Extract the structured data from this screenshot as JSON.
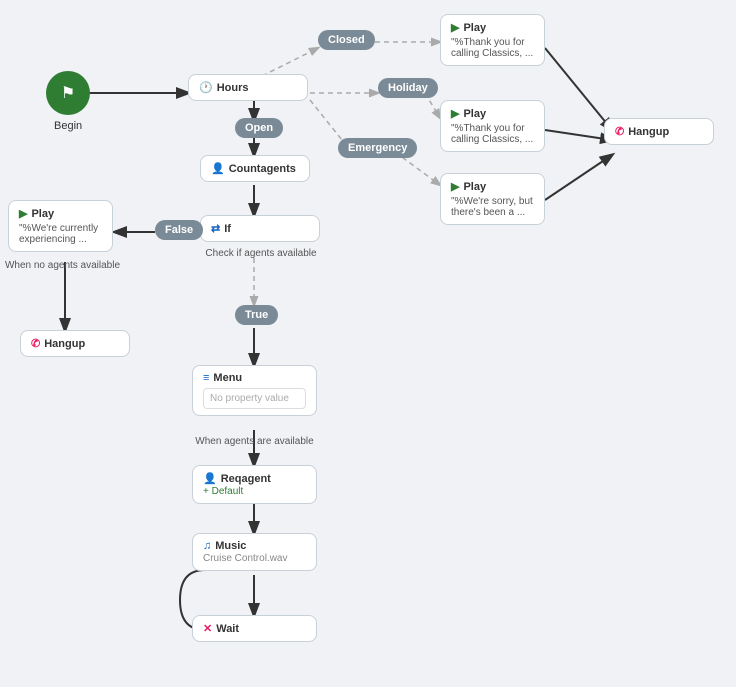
{
  "nodes": {
    "begin": {
      "label": "Begin"
    },
    "hours": {
      "label": "Hours"
    },
    "closed": {
      "label": "Closed"
    },
    "holiday": {
      "label": "Holiday"
    },
    "open": {
      "label": "Open"
    },
    "emergency": {
      "label": "Emergency"
    },
    "countagents": {
      "label": "Countagents"
    },
    "if": {
      "label": "If",
      "sublabel": "Check if agents available"
    },
    "false_pill": {
      "label": "False"
    },
    "true_pill": {
      "label": "True"
    },
    "menu": {
      "label": "Menu",
      "sublabel": "No property value",
      "footer": "When agents are available"
    },
    "reqagent": {
      "label": "Reqagent",
      "sublabel": "Default"
    },
    "music": {
      "label": "Music",
      "sublabel": "Cruise Control.wav"
    },
    "wait": {
      "label": "Wait"
    },
    "hangup_right": {
      "label": "Hangup"
    },
    "hangup_left": {
      "label": "Hangup"
    },
    "play_closed": {
      "label": "Play",
      "content": "\"%Thank you for calling Classics, ..."
    },
    "play_holiday": {
      "label": "Play",
      "content": "\"%Thank you for calling Classics, ..."
    },
    "play_emergency": {
      "label": "Play",
      "content": "\"%We're sorry, but there's been a ..."
    },
    "play_noagents": {
      "label": "Play",
      "content": "\"%We're currently experiencing ...",
      "footer": "When no agents available"
    }
  }
}
